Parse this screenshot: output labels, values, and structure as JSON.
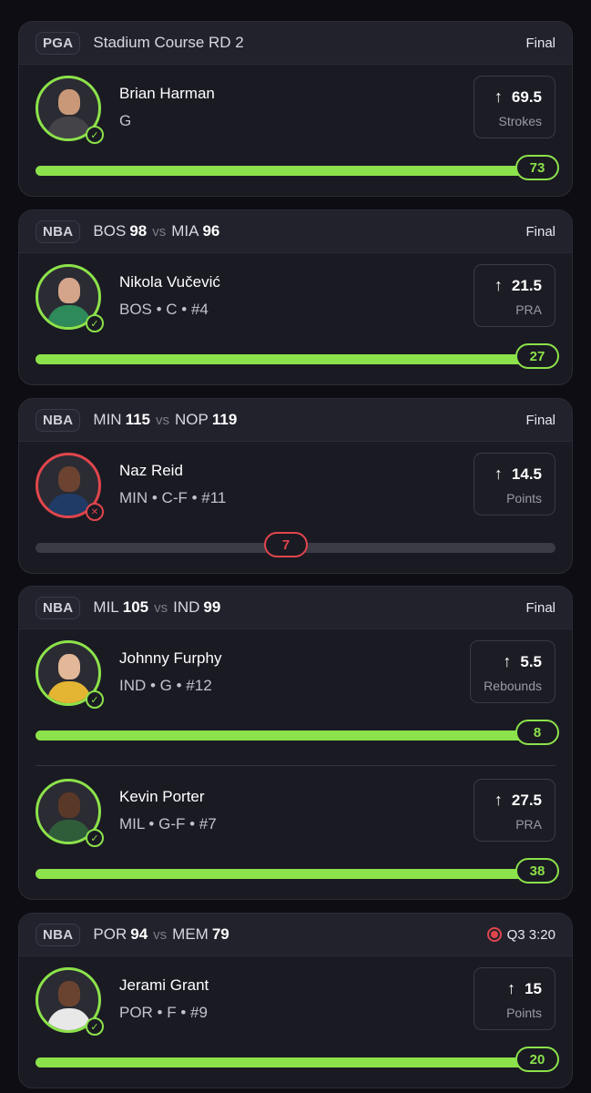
{
  "colors": {
    "win": "#8ce24a",
    "loss": "#e0464c",
    "track": "#3b3b45"
  },
  "cards": [
    {
      "league": "PGA",
      "title": "Stadium Course RD 2",
      "status": "Final",
      "players": [
        {
          "name": "Brian Harman",
          "info": "G",
          "line": "69.5",
          "stat": "Strokes",
          "result": "73",
          "outcome": "win",
          "progress": 1.0,
          "icon": "check-icon",
          "skin": "#c99878",
          "shirt": "#444448"
        }
      ]
    },
    {
      "league": "NBA",
      "away": "BOS",
      "away_score": "98",
      "vs": "vs",
      "home": "MIA",
      "home_score": "96",
      "status": "Final",
      "players": [
        {
          "name": "Nikola Vučević",
          "info": "BOS • C • #4",
          "line": "21.5",
          "stat": "PRA",
          "result": "27",
          "outcome": "win",
          "progress": 1.0,
          "icon": "check-icon",
          "skin": "#d4a58a",
          "shirt": "#2e8a5a"
        }
      ]
    },
    {
      "league": "NBA",
      "away": "MIN",
      "away_score": "115",
      "vs": "vs",
      "home": "NOP",
      "home_score": "119",
      "status": "Final",
      "players": [
        {
          "name": "Naz Reid",
          "info": "MIN • C-F • #11",
          "line": "14.5",
          "stat": "Points",
          "result": "7",
          "outcome": "loss",
          "progress": 0.48,
          "icon": "x-icon",
          "skin": "#6b4330",
          "shirt": "#1f3b66"
        }
      ]
    },
    {
      "league": "NBA",
      "away": "MIL",
      "away_score": "105",
      "vs": "vs",
      "home": "IND",
      "home_score": "99",
      "status": "Final",
      "players": [
        {
          "name": "Johnny Furphy",
          "info": "IND • G • #12",
          "line": "5.5",
          "stat": "Rebounds",
          "result": "8",
          "outcome": "win",
          "progress": 1.0,
          "icon": "check-icon",
          "skin": "#e2b898",
          "shirt": "#e4b532"
        },
        {
          "name": "Kevin Porter",
          "info": "MIL • G-F • #7",
          "line": "27.5",
          "stat": "PRA",
          "result": "38",
          "outcome": "win",
          "progress": 1.0,
          "icon": "check-icon",
          "skin": "#5a3827",
          "shirt": "#2f5d3a"
        }
      ]
    },
    {
      "league": "NBA",
      "away": "POR",
      "away_score": "94",
      "vs": "vs",
      "home": "MEM",
      "home_score": "79",
      "status": "Q3 3:20",
      "live": true,
      "players": [
        {
          "name": "Jerami Grant",
          "info": "POR • F • #9",
          "line": "15",
          "stat": "Points",
          "result": "20",
          "outcome": "win",
          "progress": 1.0,
          "icon": "check-icon",
          "skin": "#6a4330",
          "shirt": "#e8e8e8"
        }
      ]
    }
  ]
}
